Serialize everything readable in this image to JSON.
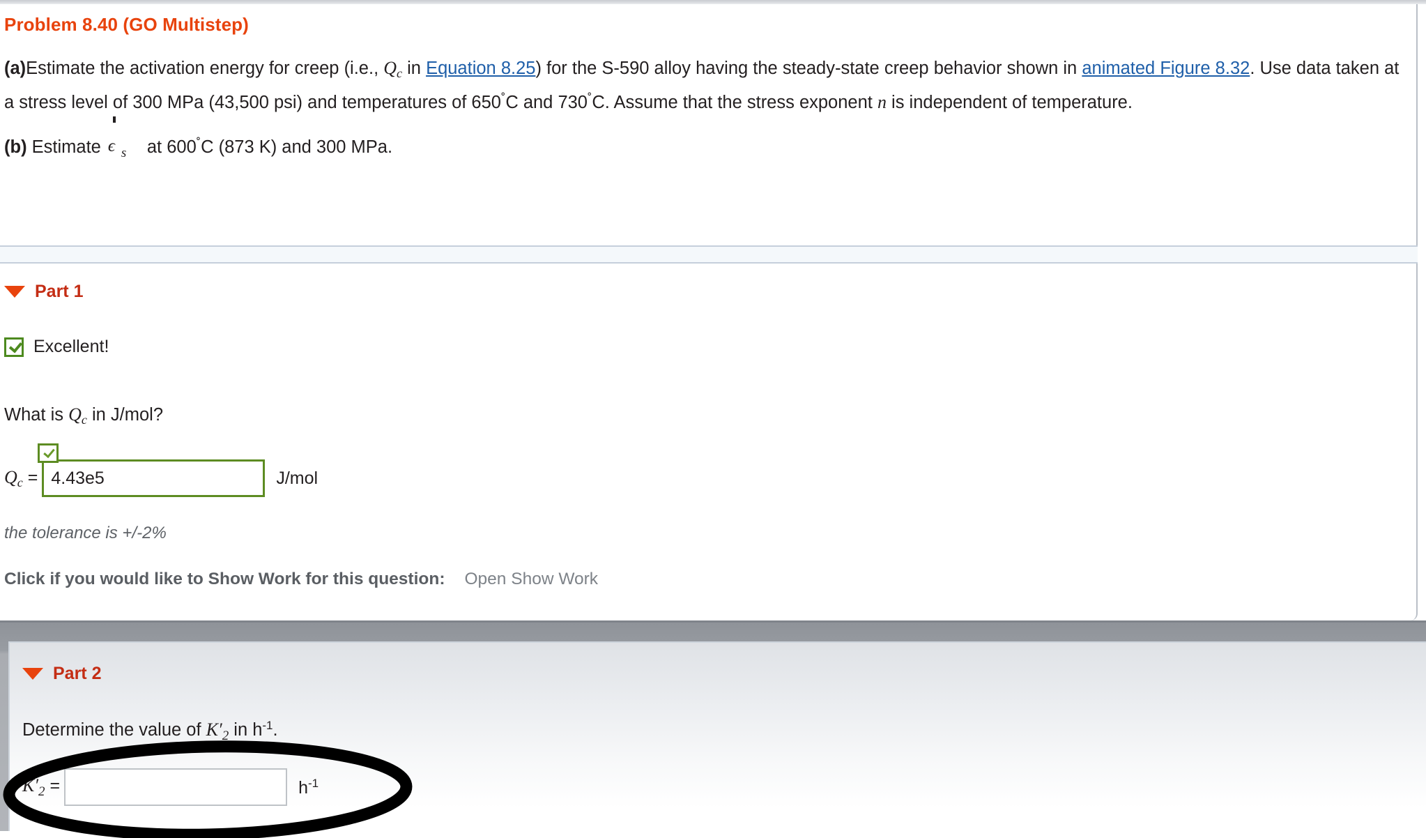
{
  "problem": {
    "title": "Problem 8.40 (GO Multistep)",
    "part_a": {
      "marker": "(a)",
      "text_1": "Estimate the activation energy for creep (i.e., ",
      "symbol_Q": "Q",
      "symbol_Q_sub": "c",
      "text_2": " in ",
      "link_equation": "Equation 8.25",
      "text_3": ") for the S-590 alloy having the steady-state creep behavior shown in ",
      "link_figure": "animated Figure 8.32",
      "text_4": ". Use data taken at a stress level of 300 MPa (43,500 psi) and temperatures of 650",
      "deg_1": "˚",
      "text_5": "C and 730",
      "deg_2": "˚",
      "text_6": "C. Assume that the stress exponent ",
      "italic_n": "n",
      "text_7": " is independent of temperature."
    },
    "part_b": {
      "marker": "(b)",
      "text_1": "Estimate",
      "epsilon": "ϵ",
      "epsilon_sub": "s",
      "text_2": "at 600",
      "deg": "˚",
      "text_3": "C (873 K) and 300 MPa."
    }
  },
  "part1": {
    "header_label": "Part 1",
    "toggle_icon": "triangle-down-icon",
    "feedback": {
      "icon": "check-icon",
      "text": "Excellent!"
    },
    "question": {
      "text_1": "What is ",
      "symbol": "Q",
      "symbol_sub": "c",
      "text_2": " in J/mol?"
    },
    "answer": {
      "label_var": "Q",
      "label_sub": "c",
      "label_eq": "=",
      "value": "4.43e5",
      "placeholder": "",
      "unit": "J/mol",
      "status_icon": "check-icon",
      "status_color": "#5d8c22"
    },
    "tolerance": "the tolerance is +/-2%",
    "show_work": {
      "prompt": "Click if you would like to Show Work for this question:",
      "link": "Open Show Work"
    }
  },
  "part2": {
    "header_label": "Part 2",
    "toggle_icon": "triangle-down-icon",
    "question": {
      "text_1": "Determine the value of ",
      "symbol": "K′",
      "symbol_sub": "2",
      "text_2": " in h",
      "exponent": "-1",
      "text_3": "."
    },
    "answer": {
      "label_var": "K′",
      "label_sub": "2",
      "label_eq": "=",
      "value": "",
      "placeholder": "",
      "unit": "h",
      "unit_exponent": "-1"
    }
  },
  "annotation": {
    "type": "hand-drawn-ellipse",
    "color": "#000000",
    "target": "part2-answer-input"
  },
  "colors": {
    "title_red": "#e8430d",
    "part_label_red": "#c42d14",
    "link_blue": "#1f5fa9",
    "correct_green": "#5d8c22",
    "body_text": "#231f20",
    "muted_gray": "#7d8288",
    "panel_gray": "#989ca2"
  }
}
